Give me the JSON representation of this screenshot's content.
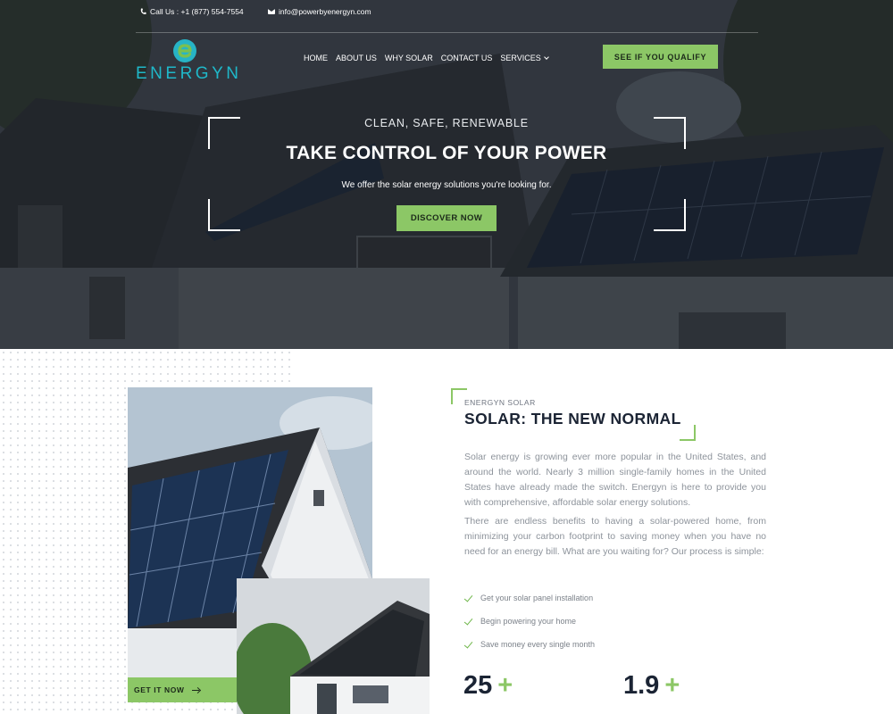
{
  "topbar": {
    "phone": "Call Us : +1 (877) 554-7554",
    "email": "info@powerbyenergyn.com"
  },
  "brand": {
    "name": "ENERGYN",
    "accent": "#8cc766",
    "logo_color": "#1fb8c9"
  },
  "nav": {
    "items": [
      "HOME",
      "ABOUT US",
      "WHY SOLAR",
      "CONTACT US",
      "SERVICES"
    ],
    "cta": "SEE IF YOU QUALIFY"
  },
  "hero": {
    "kicker": "CLEAN, SAFE, RENEWABLE",
    "title": "TAKE CONTROL OF YOUR POWER",
    "subtitle": "We offer the solar energy solutions you're looking for.",
    "button": "DISCOVER NOW"
  },
  "about": {
    "eyebrow": "ENERGYN SOLAR",
    "title": "SOLAR: THE NEW NORMAL",
    "paragraphs": [
      "Solar energy is growing ever more popular in the United States, and around the world. Nearly 3 million single-family homes in the United States have already made the switch. Energyn is here to provide you with comprehensive, affordable solar energy solutions.",
      "There are endless benefits to having a solar-powered home, from minimizing your carbon footprint to saving money when you have no need for an energy bill. What are you waiting for? Our process is simple:"
    ],
    "checklist": [
      "Get your solar panel installation",
      "Begin powering your home",
      "Save money every single month"
    ],
    "image_button": "GET IT NOW",
    "stats": [
      {
        "value": "25",
        "suffix": "+"
      },
      {
        "value": "1.9",
        "suffix": "+"
      }
    ]
  }
}
